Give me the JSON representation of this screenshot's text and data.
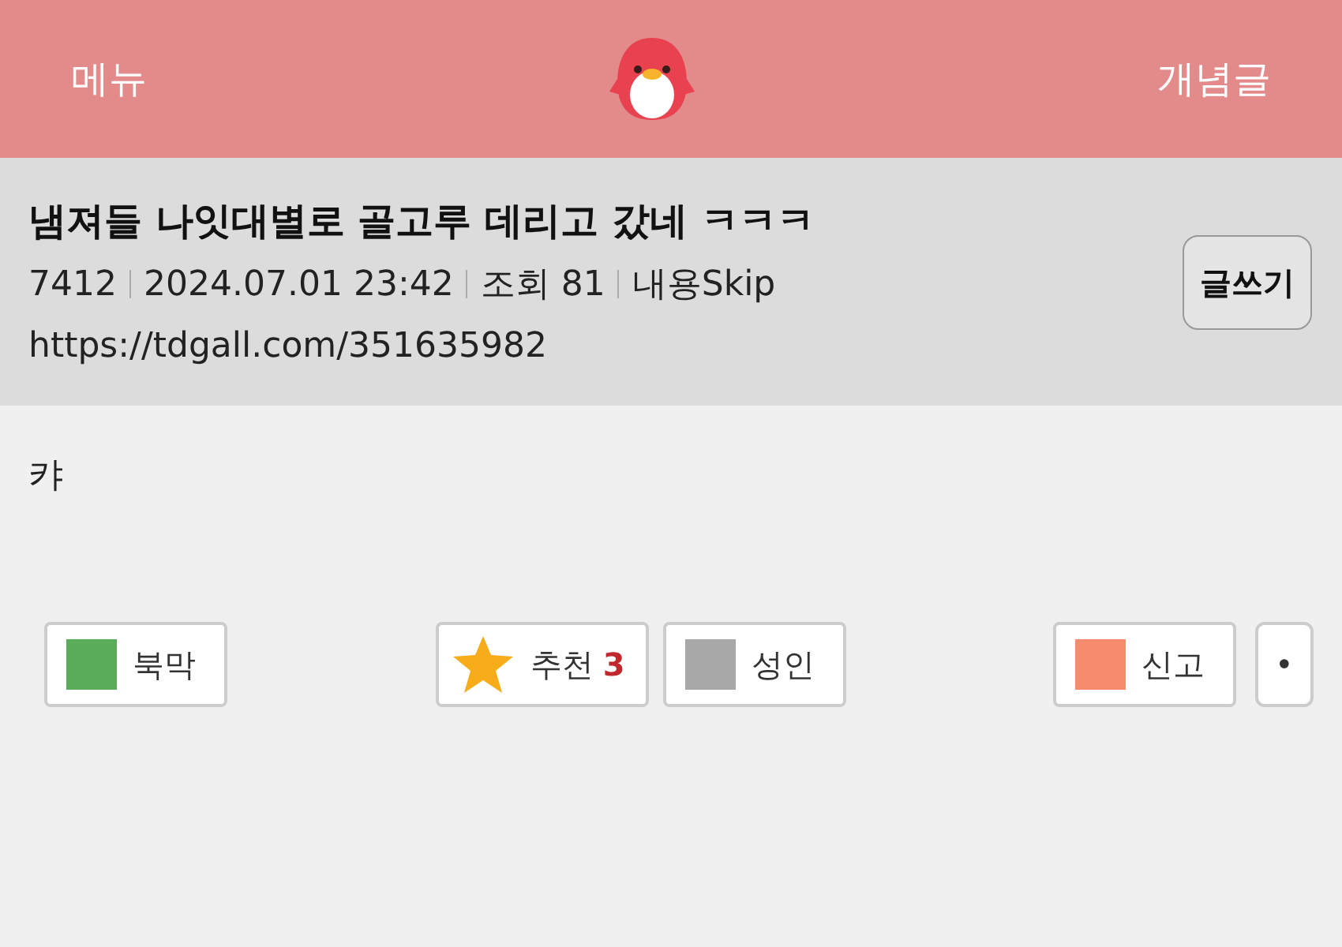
{
  "header": {
    "menu": "메뉴",
    "concept": "개념글"
  },
  "post": {
    "title": "냄져들 나잇대별로 골고루 데리고 갔네 ㅋㅋㅋ",
    "meta": [
      "7412",
      "2024.07.01 23:42",
      "조회 81",
      "내용Skip"
    ],
    "url": "https://tdgall.com/351635982",
    "write_button": "글쓰기"
  },
  "body": "캬",
  "actions": [
    {
      "kind": "square",
      "label": "북막",
      "color": "#5aab5a"
    },
    {
      "kind": "star",
      "label": "추천",
      "count": "3"
    },
    {
      "kind": "square",
      "label": "성인",
      "color": "#a8a8a8"
    },
    {
      "kind": "square",
      "label": "신고",
      "color": "#f88a6e"
    },
    {
      "kind": "plain",
      "label": "•"
    }
  ]
}
